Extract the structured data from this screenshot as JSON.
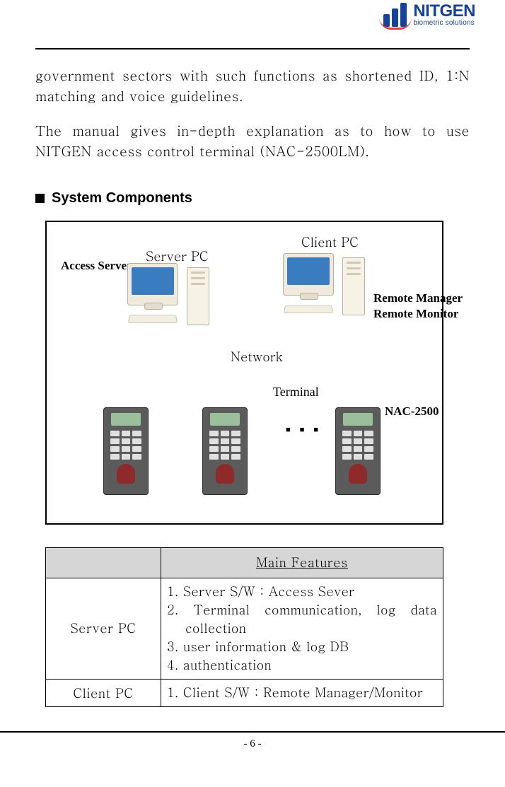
{
  "brand": {
    "name": "NITGEN",
    "tagline": "biometric solutions"
  },
  "paragraphs": {
    "p1": "government sectors with such functions as shortened ID, 1:N matching and voice guidelines.",
    "p2": "The manual gives in-depth explanation as to how to use NITGEN access control terminal (NAC-2500LM)."
  },
  "section_title": "System Components",
  "diagram": {
    "server_pc": "Server PC",
    "access_server": "Access Server",
    "client_pc": "Client PC",
    "remote_manager": "Remote Manager",
    "remote_monitor": "Remote Monitor",
    "network": "Network",
    "terminal": "Terminal",
    "nac2500": "NAC-2500",
    "dots": "■ ■ ■"
  },
  "table": {
    "header_blank": "",
    "header_main": "Main Features",
    "rows": [
      {
        "label": "Server PC",
        "lines": [
          "1. Server S/W : Access Sever",
          "2. Terminal communication, log data",
          "collection",
          "3. user information & log DB",
          "4. authentication"
        ]
      },
      {
        "label": "Client PC",
        "lines": [
          "1. Client S/W : Remote Manager/Monitor"
        ]
      }
    ]
  },
  "page_number": "- 6 -"
}
